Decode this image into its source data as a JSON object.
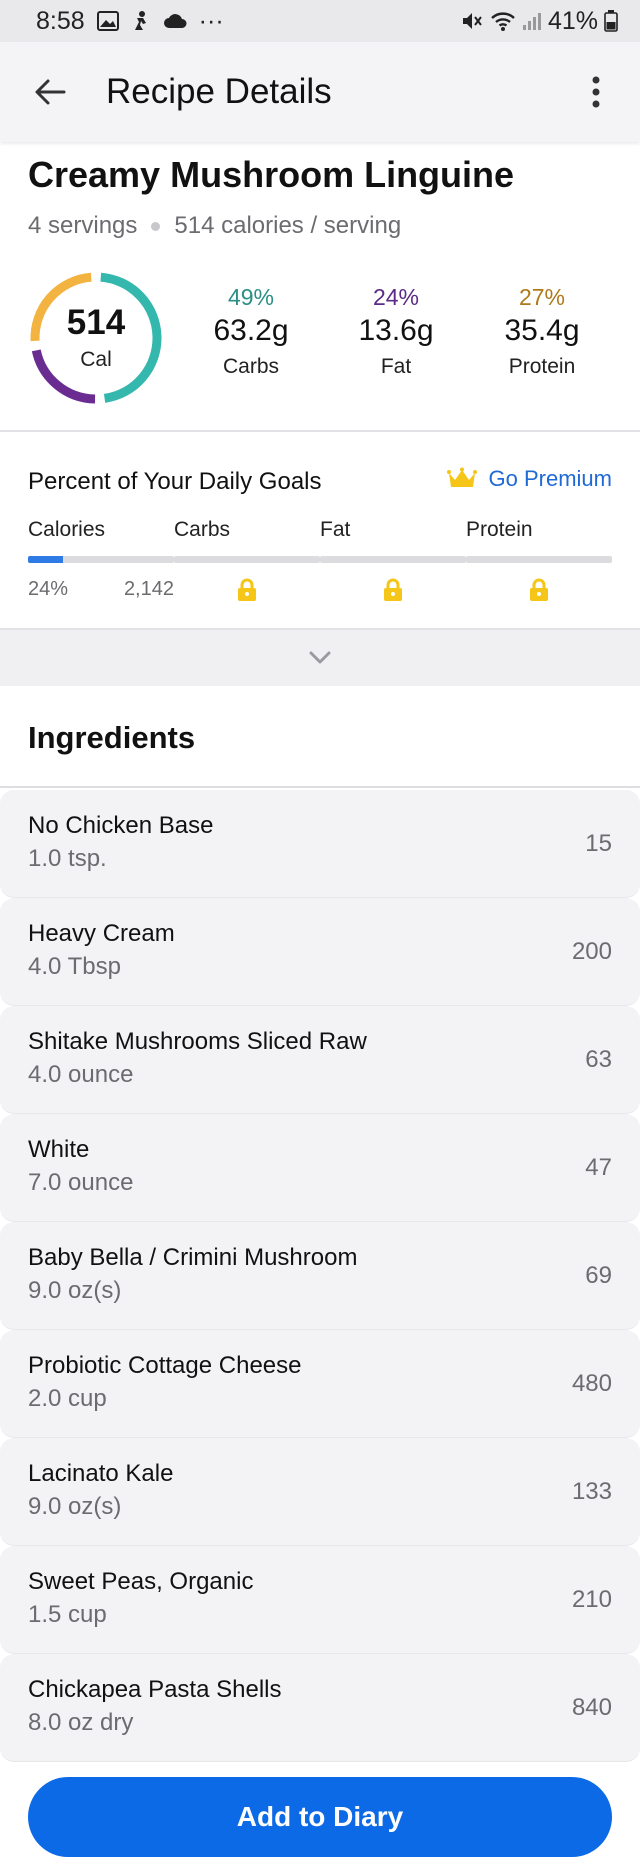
{
  "status_bar": {
    "time": "8:58",
    "more": "···",
    "battery": "41%"
  },
  "app_bar": {
    "title": "Recipe Details"
  },
  "recipe": {
    "title": "Creamy Mushroom Linguine",
    "servings": "4 servings",
    "calories_per_serving": "514 calories / serving",
    "calories": "514",
    "calories_unit": "Cal",
    "macros": [
      {
        "pct": "49%",
        "grams": "63.2g",
        "name": "Carbs",
        "color": "#2a8f86",
        "fraction": 0.49
      },
      {
        "pct": "24%",
        "grams": "13.6g",
        "name": "Fat",
        "color": "#5b2a86",
        "fraction": 0.24
      },
      {
        "pct": "27%",
        "grams": "35.4g",
        "name": "Protein",
        "color": "#b07a1a",
        "fraction": 0.27
      }
    ]
  },
  "daily_goals": {
    "title": "Percent of Your Daily Goals",
    "premium_label": "Go Premium",
    "columns": [
      {
        "name": "Calories",
        "pct": "24%",
        "goal": "2,142",
        "progress": 0.24,
        "locked": false
      },
      {
        "name": "Carbs",
        "locked": true
      },
      {
        "name": "Fat",
        "locked": true
      },
      {
        "name": "Protein",
        "locked": true
      }
    ]
  },
  "ingredients": {
    "title": "Ingredients",
    "items": [
      {
        "name": "No Chicken Base",
        "qty": "1.0 tsp.",
        "cal": "15"
      },
      {
        "name": "Heavy Cream",
        "qty": "4.0 Tbsp",
        "cal": "200"
      },
      {
        "name": "Shitake Mushrooms Sliced Raw",
        "qty": "4.0 ounce",
        "cal": "63"
      },
      {
        "name": "White",
        "qty": "7.0 ounce",
        "cal": "47"
      },
      {
        "name": "Baby Bella / Crimini Mushroom",
        "qty": "9.0 oz(s)",
        "cal": "69"
      },
      {
        "name": "Probiotic Cottage Cheese",
        "qty": "2.0 cup",
        "cal": "480"
      },
      {
        "name": "Lacinato Kale",
        "qty": "9.0 oz(s)",
        "cal": "133"
      },
      {
        "name": "Sweet Peas, Organic",
        "qty": "1.5 cup",
        "cal": "210"
      },
      {
        "name": "Chickapea Pasta Shells",
        "qty": "8.0 oz dry",
        "cal": "840"
      }
    ]
  },
  "add_button": {
    "label": "Add to Diary",
    "color": "#0c6ae6"
  },
  "colors": {
    "accent_blue": "#2f7be6",
    "link_blue": "#1f6ad6",
    "lock_yellow": "#f5c518",
    "ring_carbs": "#34b8ad",
    "ring_fat": "#6a2c91",
    "ring_protein": "#f2b340"
  }
}
